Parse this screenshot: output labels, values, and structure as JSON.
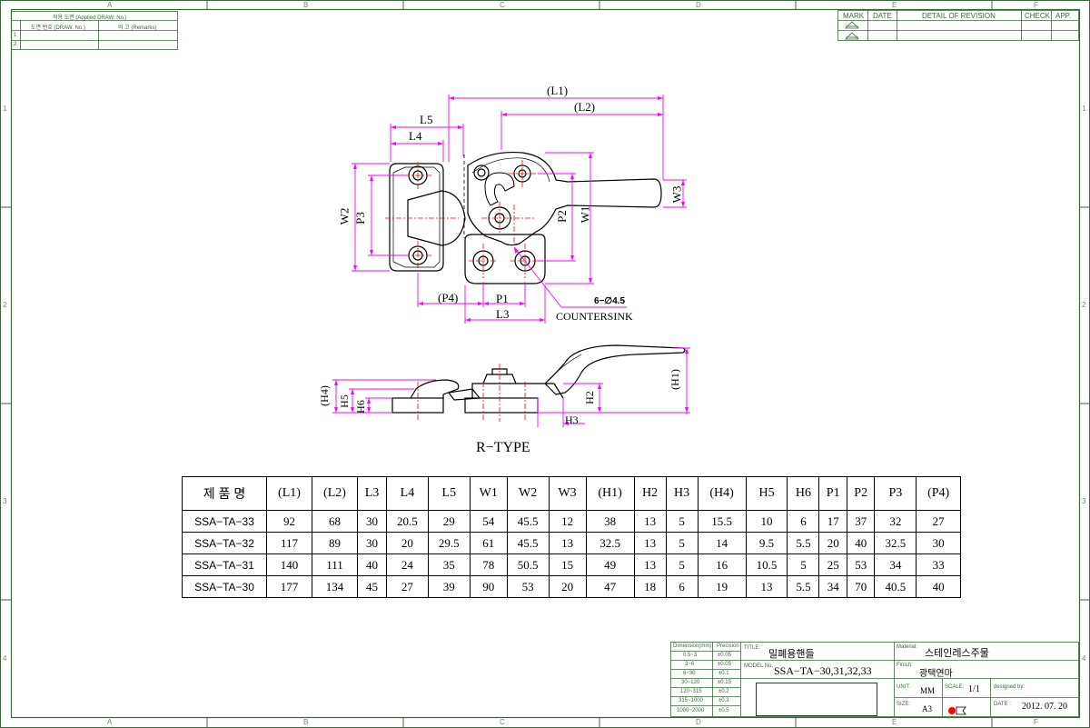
{
  "zones_top": [
    "A",
    "B",
    "C",
    "D",
    "E",
    "F"
  ],
  "zones_side": [
    "1",
    "2",
    "3",
    "4"
  ],
  "applied_box": {
    "header": "적용 도면 (Applied DRAW. No.)",
    "col1": "도면 번호 (DRAW. No.)",
    "col2": "비 고 (Remarks)",
    "rows": [
      "1",
      "2"
    ]
  },
  "revision_box": {
    "headers": [
      "MARK",
      "DATE",
      "DETAIL OF REVISION",
      "CHECK",
      "APP."
    ]
  },
  "dimension_labels": {
    "L1": "(L1)",
    "L2": "(L2)",
    "L5": "L5",
    "L4": "L4",
    "W2": "W2",
    "P3": "P3",
    "P2": "P2",
    "W1": "W1",
    "W3": "W3",
    "P4": "(P4)",
    "P1": "P1",
    "L3": "L3",
    "hole_note": "6−∅4.5",
    "countersink": "COUNTERSINK",
    "H4": "(H4)",
    "H5": "H5",
    "H6": "H6",
    "H2": "H2",
    "H3": "H3",
    "H1": "(H1)"
  },
  "view_title": "R−TYPE",
  "table": {
    "headers": [
      "제 품 명",
      "(L1)",
      "(L2)",
      "L3",
      "L4",
      "L5",
      "W1",
      "W2",
      "W3",
      "(H1)",
      "H2",
      "H3",
      "(H4)",
      "H5",
      "H6",
      "P1",
      "P2",
      "P3",
      "(P4)"
    ],
    "rows": [
      [
        "SSA−TA−33",
        "92",
        "68",
        "30",
        "20.5",
        "29",
        "54",
        "45.5",
        "12",
        "38",
        "13",
        "5",
        "15.5",
        "10",
        "6",
        "17",
        "37",
        "32",
        "27"
      ],
      [
        "SSA−TA−32",
        "117",
        "89",
        "30",
        "20",
        "29.5",
        "61",
        "45.5",
        "13",
        "32.5",
        "13",
        "5",
        "14",
        "9.5",
        "5.5",
        "20",
        "40",
        "32.5",
        "30"
      ],
      [
        "SSA−TA−31",
        "140",
        "111",
        "40",
        "24",
        "35",
        "78",
        "50.5",
        "15",
        "49",
        "13",
        "5",
        "16",
        "10.5",
        "5",
        "25",
        "53",
        "34",
        "33"
      ],
      [
        "SSA−TA−30",
        "177",
        "134",
        "45",
        "27",
        "39",
        "90",
        "53",
        "20",
        "47",
        "18",
        "6",
        "19",
        "13",
        "5.5",
        "34",
        "70",
        "40.5",
        "40"
      ]
    ]
  },
  "tolerance_table": {
    "headers": [
      "Dimension(mm)",
      "Precision"
    ],
    "rows": [
      [
        "0.5~3",
        "±0.05"
      ],
      [
        "3~6",
        "±0.05"
      ],
      [
        "6~30",
        "±0.1"
      ],
      [
        "30~120",
        "±0.15"
      ],
      [
        "120~315",
        "±0.2"
      ],
      [
        "315~1000",
        "±0.3"
      ],
      [
        "1000~2000",
        "±0.5"
      ]
    ]
  },
  "title_block": {
    "title_label": "TITLE:",
    "title": "밀폐용핸들",
    "model_label": "MODEL No.",
    "model": "SSA−TA−30,31,32,33",
    "material_label": "Material:",
    "material": "스테인레스주물",
    "finish_label": "Finish:",
    "finish": "광택연마",
    "unit_label": "UNIT:",
    "unit": "MM",
    "scale_label": "SCALE:",
    "scale": "1/1",
    "designed_label": "designed by:",
    "size_label": "SIZE:",
    "size": "A3",
    "date_label": "DATE :",
    "date": "2012. 07. 20"
  },
  "colors": {
    "dimension": "#ff00ff",
    "center": "#ff0000",
    "border": "#3a6a3a",
    "line": "#000000"
  }
}
